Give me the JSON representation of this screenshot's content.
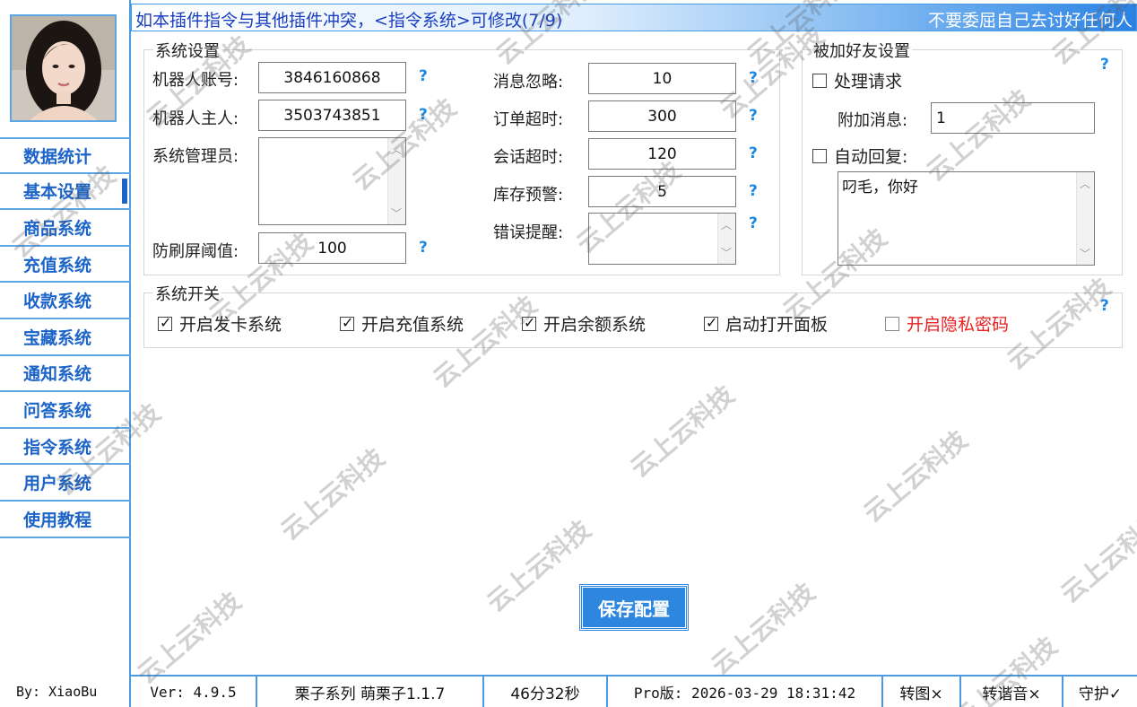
{
  "topbar": {
    "notice": "如本插件指令与其他插件冲突，<指令系统>可修改(7/9)",
    "motto": "不要委屈自己去讨好任何人"
  },
  "sidebar": {
    "items": [
      {
        "label": "数据统计",
        "active": false
      },
      {
        "label": "基本设置",
        "active": true
      },
      {
        "label": "商品系统",
        "active": false
      },
      {
        "label": "充值系统",
        "active": false
      },
      {
        "label": "收款系统",
        "active": false
      },
      {
        "label": "宝藏系统",
        "active": false
      },
      {
        "label": "通知系统",
        "active": false
      },
      {
        "label": "问答系统",
        "active": false
      },
      {
        "label": "指令系统",
        "active": false
      },
      {
        "label": "用户系统",
        "active": false
      },
      {
        "label": "使用教程",
        "active": false
      }
    ],
    "author": "By: XiaoBu"
  },
  "system_settings": {
    "title": "系统设置",
    "bot_account_label": "机器人账号:",
    "bot_account": "3846160868",
    "bot_owner_label": "机器人主人:",
    "bot_owner": "3503743851",
    "admins_label": "系统管理员:",
    "admins": "",
    "antispam_label": "防刷屏阈值:",
    "antispam": "100",
    "msg_ignore_label": "消息忽略:",
    "msg_ignore": "10",
    "order_timeout_label": "订单超时:",
    "order_timeout": "300",
    "session_timeout_label": "会话超时:",
    "session_timeout": "120",
    "stock_warning_label": "库存预警:",
    "stock_warning": "5",
    "error_reminder_label": "错误提醒:",
    "error_reminder": "",
    "help_glyph": "?"
  },
  "friend_settings": {
    "title": "被加好友设置",
    "handle_request_label": "处理请求",
    "handle_request_checked": false,
    "extra_msg_label": "附加消息:",
    "extra_msg": "1",
    "auto_reply_label": "自动回复:",
    "auto_reply_checked": false,
    "auto_reply_text": "叼毛，你好"
  },
  "switches": {
    "title": "系统开关",
    "items": [
      {
        "label": "开启发卡系统",
        "checked": true
      },
      {
        "label": "开启充值系统",
        "checked": true
      },
      {
        "label": "开启余额系统",
        "checked": true
      },
      {
        "label": "启动打开面板",
        "checked": true
      },
      {
        "label": "开启隐私密码",
        "checked": false,
        "color": "#e82020"
      }
    ]
  },
  "save_button": "保存配置",
  "statusbar": {
    "version": "Ver: 4.9.5",
    "series": "栗子系列 萌栗子1.1.7",
    "uptime": "46分32秒",
    "pro": "Pro版: 2026-03-29 18:31:42",
    "img_convert": "转图×",
    "pinyin_convert": "转谐音×",
    "guard": "守护✓"
  },
  "watermark_text": "云上云科技",
  "colors": {
    "accent": "#4a9be3",
    "nav_text": "#1c64c8",
    "help": "#1a8ae6",
    "save_bg": "#2f86de",
    "red_option": "#e82020"
  }
}
